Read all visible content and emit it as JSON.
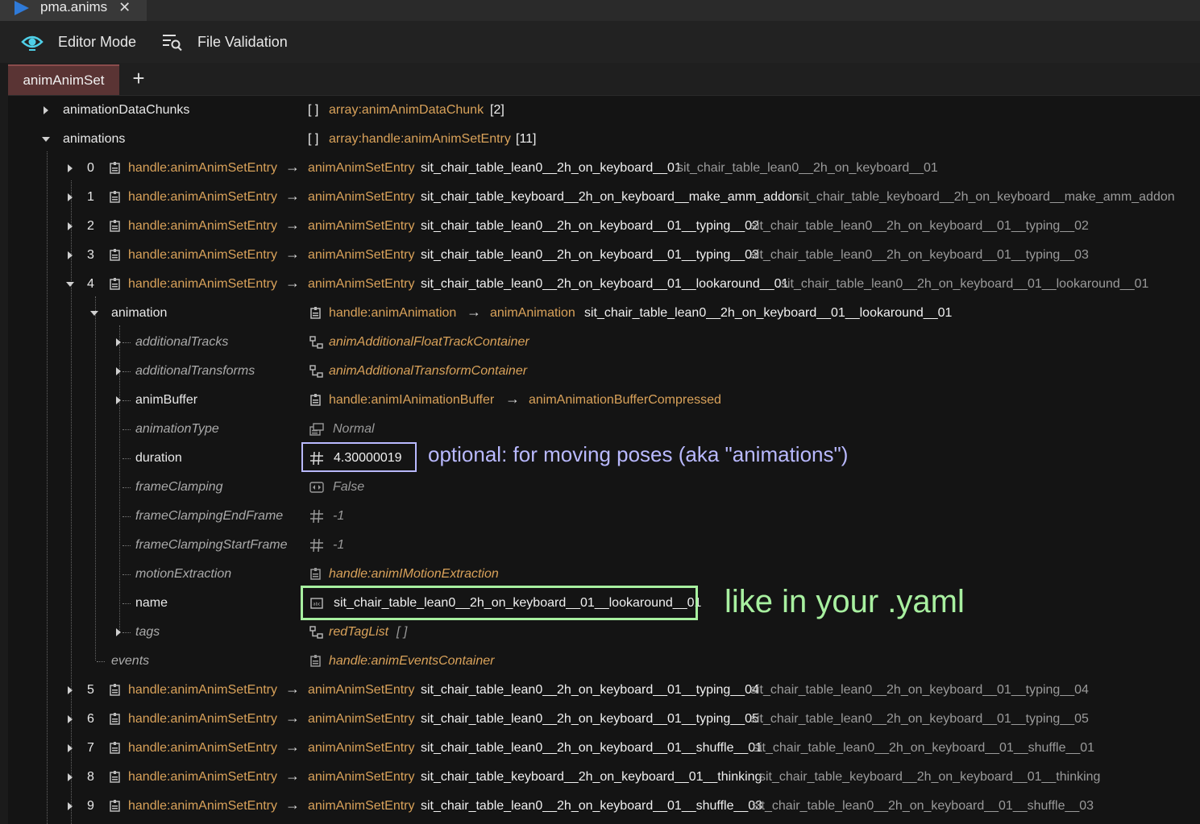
{
  "window": {
    "tab_title": "pma.anims",
    "tab_close": "✕"
  },
  "toolbar": {
    "editor_mode": "Editor Mode",
    "file_validation": "File Validation"
  },
  "panel": {
    "active_tab": "animAnimSet",
    "add_tab": "+"
  },
  "common": {
    "handle_entry": "handle:animAnimSetEntry",
    "entry_type": "animAnimSetEntry",
    "arrow": "→",
    "array_bracket": "[ ]"
  },
  "tree": {
    "animationDataChunks": {
      "key": "animationDataChunks",
      "type": "array:animAnimDataChunk",
      "count": "[2]"
    },
    "animations": {
      "key": "animations",
      "type": "array:handle:animAnimSetEntry",
      "count": "[11]"
    },
    "entries_before": [
      {
        "index": "0",
        "name": "sit_chair_table_lean0__2h_on_keyboard__01",
        "display": "sit_chair_table_lean0__2h_on_keyboard__01"
      },
      {
        "index": "1",
        "name": "sit_chair_table_keyboard__2h_on_keyboard__make_amm_addon",
        "display": "sit_chair_table_keyboard__2h_on_keyboard__make_amm_addon"
      },
      {
        "index": "2",
        "name": "sit_chair_table_lean0__2h_on_keyboard__01__typing__02",
        "display": "sit_chair_table_lean0__2h_on_keyboard__01__typing__02"
      },
      {
        "index": "3",
        "name": "sit_chair_table_lean0__2h_on_keyboard__01__typing__03",
        "display": "sit_chair_table_lean0__2h_on_keyboard__01__typing__03"
      },
      {
        "index": "4",
        "name": "sit_chair_table_lean0__2h_on_keyboard__01__lookaround__01",
        "display": "sit_chair_table_lean0__2h_on_keyboard__01__lookaround__01"
      }
    ],
    "animation": {
      "key": "animation",
      "handle": "handle:animAnimation",
      "type": "animAnimation",
      "name": "sit_chair_table_lean0__2h_on_keyboard__01__lookaround__01",
      "fields": {
        "additionalTracks": {
          "key": "additionalTracks",
          "value": "animAdditionalFloatTrackContainer"
        },
        "additionalTransforms": {
          "key": "additionalTransforms",
          "value": "animAdditionalTransformContainer"
        },
        "animBuffer": {
          "key": "animBuffer",
          "handle": "handle:animIAnimationBuffer",
          "value": "animAnimationBufferCompressed"
        },
        "animationType": {
          "key": "animationType",
          "value": "Normal"
        },
        "duration": {
          "key": "duration",
          "value": "4.30000019"
        },
        "frameClamping": {
          "key": "frameClamping",
          "value": "False"
        },
        "frameClampingEndFrame": {
          "key": "frameClampingEndFrame",
          "value": "-1"
        },
        "frameClampingStartFrame": {
          "key": "frameClampingStartFrame",
          "value": "-1"
        },
        "motionExtraction": {
          "key": "motionExtraction",
          "value": "handle:animIMotionExtraction"
        },
        "name": {
          "key": "name",
          "value": "sit_chair_table_lean0__2h_on_keyboard__01__lookaround__01"
        },
        "tags": {
          "key": "tags",
          "value": "redTagList",
          "extra": "[ ]"
        }
      }
    },
    "events": {
      "key": "events",
      "value": "handle:animEventsContainer"
    },
    "entries_after": [
      {
        "index": "5",
        "name": "sit_chair_table_lean0__2h_on_keyboard__01__typing__04",
        "display": "sit_chair_table_lean0__2h_on_keyboard__01__typing__04"
      },
      {
        "index": "6",
        "name": "sit_chair_table_lean0__2h_on_keyboard__01__typing__05",
        "display": "sit_chair_table_lean0__2h_on_keyboard__01__typing__05"
      },
      {
        "index": "7",
        "name": "sit_chair_table_lean0__2h_on_keyboard__01__shuffle__01",
        "display": "sit_chair_table_lean0__2h_on_keyboard__01__shuffle__01"
      },
      {
        "index": "8",
        "name": "sit_chair_table_keyboard__2h_on_keyboard__01__thinking",
        "display": "sit_chair_table_keyboard__2h_on_keyboard__01__thinking"
      },
      {
        "index": "9",
        "name": "sit_chair_table_lean0__2h_on_keyboard__01__shuffle__03",
        "display": "sit_chair_table_lean0__2h_on_keyboard__01__shuffle__03"
      }
    ]
  },
  "annotations": {
    "duration_note": "optional: for moving poses (aka \"animations\")",
    "name_note": "like in your .yaml",
    "duration_color": "#b9b9ff",
    "name_color": "#a8f0a0"
  },
  "colors": {
    "type_orange": "#d9a25a",
    "tab_red": "#5a3434",
    "accent_blue": "#2f7ad8",
    "eye_cyan": "#4fd0e8"
  }
}
